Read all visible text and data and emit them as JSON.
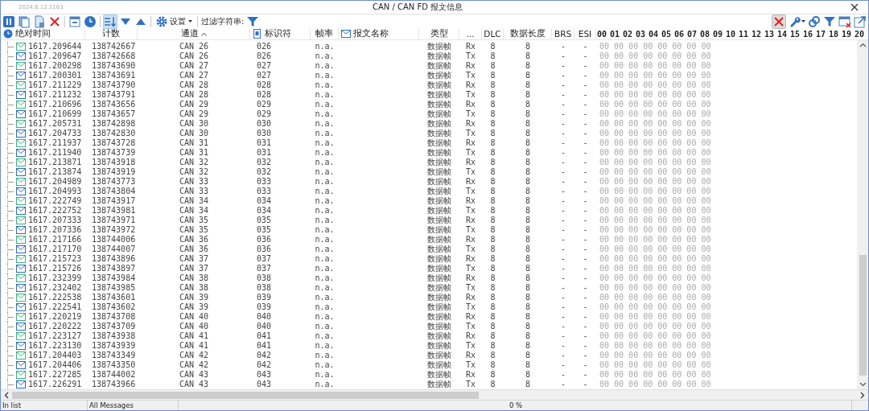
{
  "window": {
    "version": "2024.8.12.1163",
    "title": "CAN / CAN FD 报文信息"
  },
  "toolbar": {
    "left": [
      {
        "kind": "pause",
        "active": false
      },
      {
        "kind": "copy",
        "active": false
      },
      {
        "kind": "copy-list",
        "active": false
      },
      {
        "kind": "delete",
        "active": false
      },
      {
        "kind": "sep"
      },
      {
        "kind": "window",
        "active": false
      },
      {
        "kind": "clock",
        "active": false
      },
      {
        "kind": "sep"
      },
      {
        "kind": "sort",
        "active": true
      },
      {
        "kind": "down",
        "active": false
      },
      {
        "kind": "up",
        "active": false
      },
      {
        "kind": "sep"
      }
    ],
    "settings_label": "设置",
    "filter_label": "过滤字符串:",
    "right": [
      {
        "kind": "delete",
        "active": true
      },
      {
        "kind": "wrench",
        "active": false
      },
      {
        "kind": "link",
        "active": false
      },
      {
        "kind": "funnel",
        "active": false
      },
      {
        "kind": "window-x",
        "active": false
      },
      {
        "kind": "export",
        "active": false
      }
    ]
  },
  "columns": [
    {
      "label": "绝对时间",
      "sorted": false
    },
    {
      "label": "计数",
      "sorted": false
    },
    {
      "label": "通道",
      "sorted": true
    },
    {
      "label": "标识符",
      "sorted": false
    },
    {
      "label": "帧率",
      "sorted": false
    },
    {
      "label": "报文名称",
      "sorted": false
    },
    {
      "label": "类型"
    },
    {
      "label": "..."
    },
    {
      "label": "DLC"
    },
    {
      "label": "数据长度"
    },
    {
      "label": "BRS"
    },
    {
      "label": "ESI"
    }
  ],
  "byte_columns": [
    "00",
    "01",
    "02",
    "03",
    "04",
    "05",
    "06",
    "07",
    "08",
    "09",
    "10",
    "11",
    "12",
    "13",
    "14",
    "15",
    "16",
    "17",
    "18",
    "19",
    "20"
  ],
  "rows": [
    {
      "time": "1617.209644",
      "count": "138742667",
      "channel": "CAN 26",
      "id": "026",
      "rate": "n.a.",
      "type": "数据帧",
      "dir": "Rx",
      "dlc": "8",
      "length": "8",
      "brs": "-",
      "esi": "-",
      "data": "00 00 00 00 00 00 00 00",
      "color": "#3cb27e"
    },
    {
      "time": "1617.209647",
      "count": "138742668",
      "channel": "CAN 26",
      "id": "026",
      "rate": "n.a.",
      "type": "数据帧",
      "dir": "Tx",
      "dlc": "8",
      "length": "8",
      "brs": "-",
      "esi": "-",
      "data": "00 00 00 00 00 00 00 00",
      "color": "#2f6db5"
    },
    {
      "time": "1617.200298",
      "count": "138743690",
      "channel": "CAN 27",
      "id": "027",
      "rate": "n.a.",
      "type": "数据帧",
      "dir": "Rx",
      "dlc": "8",
      "length": "8",
      "brs": "-",
      "esi": "-",
      "data": "00 00 00 00 00 00 00 00",
      "color": "#3cb27e"
    },
    {
      "time": "1617.200301",
      "count": "138743691",
      "channel": "CAN 27",
      "id": "027",
      "rate": "n.a.",
      "type": "数据帧",
      "dir": "Tx",
      "dlc": "8",
      "length": "8",
      "brs": "-",
      "esi": "-",
      "data": "00 00 00 00 00 00 00 00",
      "color": "#2f6db5"
    },
    {
      "time": "1617.211229",
      "count": "138743790",
      "channel": "CAN 28",
      "id": "028",
      "rate": "n.a.",
      "type": "数据帧",
      "dir": "Rx",
      "dlc": "8",
      "length": "8",
      "brs": "-",
      "esi": "-",
      "data": "00 00 00 00 00 00 00 00",
      "color": "#3cb27e"
    },
    {
      "time": "1617.211232",
      "count": "138743791",
      "channel": "CAN 28",
      "id": "028",
      "rate": "n.a.",
      "type": "数据帧",
      "dir": "Tx",
      "dlc": "8",
      "length": "8",
      "brs": "-",
      "esi": "-",
      "data": "00 00 00 00 00 00 00 00",
      "color": "#2f6db5"
    },
    {
      "time": "1617.210696",
      "count": "138743656",
      "channel": "CAN 29",
      "id": "029",
      "rate": "n.a.",
      "type": "数据帧",
      "dir": "Rx",
      "dlc": "8",
      "length": "8",
      "brs": "-",
      "esi": "-",
      "data": "00 00 00 00 00 00 00 00",
      "color": "#3cb27e"
    },
    {
      "time": "1617.210699",
      "count": "138743657",
      "channel": "CAN 29",
      "id": "029",
      "rate": "n.a.",
      "type": "数据帧",
      "dir": "Tx",
      "dlc": "8",
      "length": "8",
      "brs": "-",
      "esi": "-",
      "data": "00 00 00 00 00 00 00 00",
      "color": "#2f6db5"
    },
    {
      "time": "1617.205731",
      "count": "138742898",
      "channel": "CAN 30",
      "id": "030",
      "rate": "n.a.",
      "type": "数据帧",
      "dir": "Rx",
      "dlc": "8",
      "length": "8",
      "brs": "-",
      "esi": "-",
      "data": "00 00 00 00 00 00 00 00",
      "color": "#3cb27e"
    },
    {
      "time": "1617.204733",
      "count": "138742830",
      "channel": "CAN 30",
      "id": "030",
      "rate": "n.a.",
      "type": "数据帧",
      "dir": "Tx",
      "dlc": "8",
      "length": "8",
      "brs": "-",
      "esi": "-",
      "data": "00 00 00 00 00 00 00 00",
      "color": "#2f6db5"
    },
    {
      "time": "1617.211937",
      "count": "138743728",
      "channel": "CAN 31",
      "id": "031",
      "rate": "n.a.",
      "type": "数据帧",
      "dir": "Rx",
      "dlc": "8",
      "length": "8",
      "brs": "-",
      "esi": "-",
      "data": "00 00 00 00 00 00 00 00",
      "color": "#3cb27e"
    },
    {
      "time": "1617.211940",
      "count": "138743739",
      "channel": "CAN 31",
      "id": "031",
      "rate": "n.a.",
      "type": "数据帧",
      "dir": "Tx",
      "dlc": "8",
      "length": "8",
      "brs": "-",
      "esi": "-",
      "data": "00 00 00 00 00 00 00 00",
      "color": "#2f6db5"
    },
    {
      "time": "1617.213871",
      "count": "138743918",
      "channel": "CAN 32",
      "id": "032",
      "rate": "n.a.",
      "type": "数据帧",
      "dir": "Rx",
      "dlc": "8",
      "length": "8",
      "brs": "-",
      "esi": "-",
      "data": "00 00 00 00 00 00 00 00",
      "color": "#3cb27e"
    },
    {
      "time": "1617.213874",
      "count": "138743919",
      "channel": "CAN 32",
      "id": "032",
      "rate": "n.a.",
      "type": "数据帧",
      "dir": "Tx",
      "dlc": "8",
      "length": "8",
      "brs": "-",
      "esi": "-",
      "data": "00 00 00 00 00 00 00 00",
      "color": "#2f6db5"
    },
    {
      "time": "1617.204989",
      "count": "138743773",
      "channel": "CAN 33",
      "id": "033",
      "rate": "n.a.",
      "type": "数据帧",
      "dir": "Rx",
      "dlc": "8",
      "length": "8",
      "brs": "-",
      "esi": "-",
      "data": "00 00 00 00 00 00 00 00",
      "color": "#3cb27e"
    },
    {
      "time": "1617.204993",
      "count": "138743804",
      "channel": "CAN 33",
      "id": "033",
      "rate": "n.a.",
      "type": "数据帧",
      "dir": "Tx",
      "dlc": "8",
      "length": "8",
      "brs": "-",
      "esi": "-",
      "data": "00 00 00 00 00 00 00 00",
      "color": "#2f6db5"
    },
    {
      "time": "1617.222749",
      "count": "138743917",
      "channel": "CAN 34",
      "id": "034",
      "rate": "n.a.",
      "type": "数据帧",
      "dir": "Rx",
      "dlc": "8",
      "length": "8",
      "brs": "-",
      "esi": "-",
      "data": "00 00 00 00 00 00 00 00",
      "color": "#3cb27e"
    },
    {
      "time": "1617.222752",
      "count": "138743981",
      "channel": "CAN 34",
      "id": "034",
      "rate": "n.a.",
      "type": "数据帧",
      "dir": "Tx",
      "dlc": "8",
      "length": "8",
      "brs": "-",
      "esi": "-",
      "data": "00 00 00 00 00 00 00 00",
      "color": "#2f6db5"
    },
    {
      "time": "1617.207333",
      "count": "138743971",
      "channel": "CAN 35",
      "id": "035",
      "rate": "n.a.",
      "type": "数据帧",
      "dir": "Rx",
      "dlc": "8",
      "length": "8",
      "brs": "-",
      "esi": "-",
      "data": "00 00 00 00 00 00 00 00",
      "color": "#3cb27e"
    },
    {
      "time": "1617.207336",
      "count": "138743972",
      "channel": "CAN 35",
      "id": "035",
      "rate": "n.a.",
      "type": "数据帧",
      "dir": "Tx",
      "dlc": "8",
      "length": "8",
      "brs": "-",
      "esi": "-",
      "data": "00 00 00 00 00 00 00 00",
      "color": "#2f6db5"
    },
    {
      "time": "1617.217166",
      "count": "138744006",
      "channel": "CAN 36",
      "id": "036",
      "rate": "n.a.",
      "type": "数据帧",
      "dir": "Rx",
      "dlc": "8",
      "length": "8",
      "brs": "-",
      "esi": "-",
      "data": "00 00 00 00 00 00 00 00",
      "color": "#3cb27e"
    },
    {
      "time": "1617.217170",
      "count": "138744007",
      "channel": "CAN 36",
      "id": "036",
      "rate": "n.a.",
      "type": "数据帧",
      "dir": "Tx",
      "dlc": "8",
      "length": "8",
      "brs": "-",
      "esi": "-",
      "data": "00 00 00 00 00 00 00 00",
      "color": "#2f6db5"
    },
    {
      "time": "1617.215723",
      "count": "138743896",
      "channel": "CAN 37",
      "id": "037",
      "rate": "n.a.",
      "type": "数据帧",
      "dir": "Rx",
      "dlc": "8",
      "length": "8",
      "brs": "-",
      "esi": "-",
      "data": "00 00 00 00 00 00 00 00",
      "color": "#3cb27e"
    },
    {
      "time": "1617.215726",
      "count": "138743897",
      "channel": "CAN 37",
      "id": "037",
      "rate": "n.a.",
      "type": "数据帧",
      "dir": "Tx",
      "dlc": "8",
      "length": "8",
      "brs": "-",
      "esi": "-",
      "data": "00 00 00 00 00 00 00 00",
      "color": "#2f6db5"
    },
    {
      "time": "1617.232399",
      "count": "138743984",
      "channel": "CAN 38",
      "id": "038",
      "rate": "n.a.",
      "type": "数据帧",
      "dir": "Rx",
      "dlc": "8",
      "length": "8",
      "brs": "-",
      "esi": "-",
      "data": "00 00 00 00 00 00 00 00",
      "color": "#3cb27e"
    },
    {
      "time": "1617.232402",
      "count": "138743985",
      "channel": "CAN 38",
      "id": "038",
      "rate": "n.a.",
      "type": "数据帧",
      "dir": "Tx",
      "dlc": "8",
      "length": "8",
      "brs": "-",
      "esi": "-",
      "data": "00 00 00 00 00 00 00 00",
      "color": "#2f6db5"
    },
    {
      "time": "1617.222538",
      "count": "138743601",
      "channel": "CAN 39",
      "id": "039",
      "rate": "n.a.",
      "type": "数据帧",
      "dir": "Rx",
      "dlc": "8",
      "length": "8",
      "brs": "-",
      "esi": "-",
      "data": "00 00 00 00 00 00 00 00",
      "color": "#3cb27e"
    },
    {
      "time": "1617.222541",
      "count": "138743602",
      "channel": "CAN 39",
      "id": "039",
      "rate": "n.a.",
      "type": "数据帧",
      "dir": "Tx",
      "dlc": "8",
      "length": "8",
      "brs": "-",
      "esi": "-",
      "data": "00 00 00 00 00 00 00 00",
      "color": "#2f6db5"
    },
    {
      "time": "1617.220219",
      "count": "138743708",
      "channel": "CAN 40",
      "id": "040",
      "rate": "n.a.",
      "type": "数据帧",
      "dir": "Rx",
      "dlc": "8",
      "length": "8",
      "brs": "-",
      "esi": "-",
      "data": "00 00 00 00 00 00 00 00",
      "color": "#3cb27e"
    },
    {
      "time": "1617.220222",
      "count": "138743709",
      "channel": "CAN 40",
      "id": "040",
      "rate": "n.a.",
      "type": "数据帧",
      "dir": "Tx",
      "dlc": "8",
      "length": "8",
      "brs": "-",
      "esi": "-",
      "data": "00 00 00 00 00 00 00 00",
      "color": "#2f6db5"
    },
    {
      "time": "1617.223127",
      "count": "138743938",
      "channel": "CAN 41",
      "id": "041",
      "rate": "n.a.",
      "type": "数据帧",
      "dir": "Rx",
      "dlc": "8",
      "length": "8",
      "brs": "-",
      "esi": "-",
      "data": "00 00 00 00 00 00 00 00",
      "color": "#3cb27e"
    },
    {
      "time": "1617.223130",
      "count": "138743939",
      "channel": "CAN 41",
      "id": "041",
      "rate": "n.a.",
      "type": "数据帧",
      "dir": "Tx",
      "dlc": "8",
      "length": "8",
      "brs": "-",
      "esi": "-",
      "data": "00 00 00 00 00 00 00 00",
      "color": "#2f6db5"
    },
    {
      "time": "1617.204403",
      "count": "138743349",
      "channel": "CAN 42",
      "id": "042",
      "rate": "n.a.",
      "type": "数据帧",
      "dir": "Rx",
      "dlc": "8",
      "length": "8",
      "brs": "-",
      "esi": "-",
      "data": "00 00 00 00 00 00 00 00",
      "color": "#3cb27e"
    },
    {
      "time": "1617.204406",
      "count": "138743350",
      "channel": "CAN 42",
      "id": "042",
      "rate": "n.a.",
      "type": "数据帧",
      "dir": "Tx",
      "dlc": "8",
      "length": "8",
      "brs": "-",
      "esi": "-",
      "data": "00 00 00 00 00 00 00 00",
      "color": "#2f6db5"
    },
    {
      "time": "1617.227285",
      "count": "138744002",
      "channel": "CAN 43",
      "id": "043",
      "rate": "n.a.",
      "type": "数据帧",
      "dir": "Rx",
      "dlc": "8",
      "length": "8",
      "brs": "-",
      "esi": "-",
      "data": "00 00 00 00 00 00 00 00",
      "color": "#3cb27e"
    },
    {
      "time": "1617.226291",
      "count": "138743966",
      "channel": "CAN 43",
      "id": "043",
      "rate": "n.a.",
      "type": "数据帧",
      "dir": "Tx",
      "dlc": "8",
      "length": "8",
      "brs": "-",
      "esi": "-",
      "data": "00 00 00 00 00 00 00 00",
      "color": "#2f6db5"
    }
  ],
  "status_bar": [
    "In list",
    "All Messages",
    "0 %"
  ]
}
